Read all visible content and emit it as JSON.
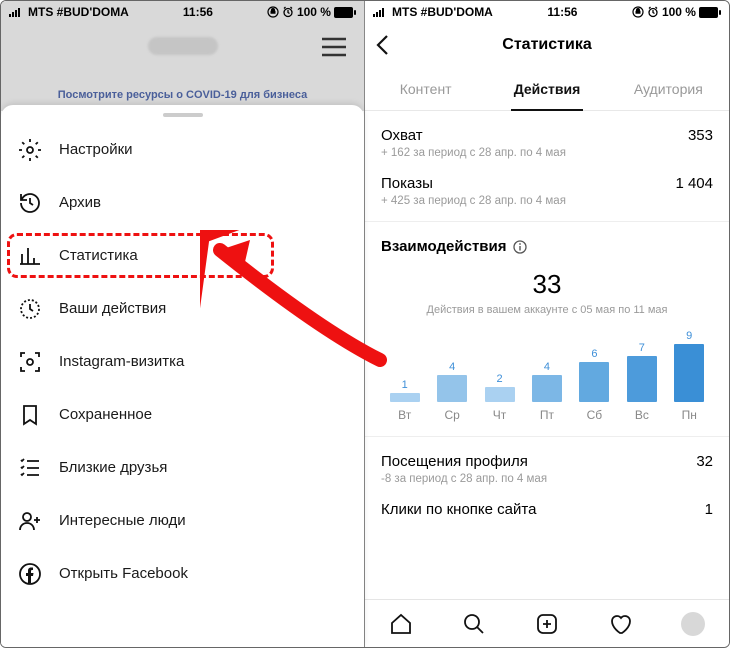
{
  "status": {
    "carrier": "MTS #BUD'DOMA",
    "time": "11:56",
    "battery": "100 %"
  },
  "left": {
    "covid_banner": "Посмотрите ресурсы о COVID-19 для бизнеса",
    "menu": [
      {
        "icon": "gear-icon",
        "label": "Настройки"
      },
      {
        "icon": "clock-icon",
        "label": "Архив"
      },
      {
        "icon": "stats-icon",
        "label": "Статистика"
      },
      {
        "icon": "activity-icon",
        "label": "Ваши действия"
      },
      {
        "icon": "scan-icon",
        "label": "Instagram-визитка"
      },
      {
        "icon": "bookmark-icon",
        "label": "Сохраненное"
      },
      {
        "icon": "close-friends-icon",
        "label": "Близкие друзья"
      },
      {
        "icon": "discover-people-icon",
        "label": "Интересные люди"
      },
      {
        "icon": "facebook-icon",
        "label": "Открыть Facebook"
      }
    ]
  },
  "right": {
    "title": "Статистика",
    "tabs": {
      "content": "Контент",
      "actions": "Действия",
      "audience": "Аудитория"
    },
    "reach": {
      "label": "Охват",
      "value": "353",
      "sub": "+ 162 за период с 28 апр. по 4 мая"
    },
    "impr": {
      "label": "Показы",
      "value": "1 404",
      "sub": "+ 425 за период с 28 апр. по 4 мая"
    },
    "inter": {
      "label": "Взаимодействия",
      "value": "33",
      "sub": "Действия в вашем аккаунте с 05 мая по 11 мая"
    },
    "profile": {
      "label": "Посещения профиля",
      "value": "32",
      "sub": "-8 за период с 28 апр. по 4 мая"
    },
    "clicks": {
      "label": "Клики по кнопке сайта",
      "value": "1"
    }
  },
  "chart_data": {
    "type": "bar",
    "categories": [
      "Вт",
      "Ср",
      "Чт",
      "Пт",
      "Сб",
      "Вс",
      "Пн"
    ],
    "values": [
      1,
      4,
      2,
      4,
      6,
      7,
      9
    ],
    "title": "",
    "xlabel": "",
    "ylabel": "",
    "ylim": [
      0,
      9
    ],
    "colors": [
      "#aad1f1",
      "#94c4ea",
      "#aad1f1",
      "#7cb7e6",
      "#62a9e0",
      "#4d9bdb",
      "#3a8fd6"
    ]
  }
}
